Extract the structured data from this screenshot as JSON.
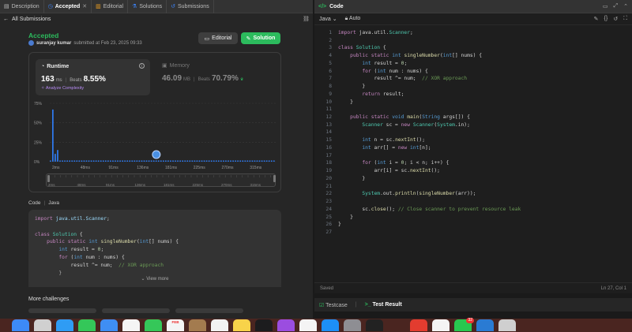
{
  "tabs": [
    {
      "label": "Description",
      "icon": "description-icon"
    },
    {
      "label": "Accepted",
      "icon": "history-icon",
      "active": true
    },
    {
      "label": "Editorial",
      "icon": "book-icon"
    },
    {
      "label": "Solutions",
      "icon": "flask-icon"
    },
    {
      "label": "Submissions",
      "icon": "clock-icon"
    }
  ],
  "back_label": "All Submissions",
  "result": {
    "status": "Accepted",
    "user": "suranjay kumar",
    "submitted_text": "submitted at Feb 23, 2025 09:33"
  },
  "buttons": {
    "editorial": "Editorial",
    "solution": "Solution"
  },
  "runtime": {
    "title": "Runtime",
    "value": "163",
    "unit": "ms",
    "beats_label": "Beats",
    "beats": "8.55%",
    "analyze": "Analyze Complexity"
  },
  "memory": {
    "title": "Memory",
    "value": "46.09",
    "unit": "MB",
    "beats_label": "Beats",
    "beats": "70.79%"
  },
  "chart_data": {
    "type": "bar",
    "y_ticks": [
      "75%",
      "50%",
      "25%",
      "0%"
    ],
    "ylim": [
      0,
      75
    ],
    "x_ticks": [
      "2ms",
      "48ms",
      "91ms",
      "136ms",
      "181ms",
      "225ms",
      "270ms",
      "315ms"
    ],
    "values": [
      1.5,
      67,
      10,
      15,
      1.5,
      1.5,
      1.5,
      1.5,
      1.5,
      1.5,
      1.5,
      1.5,
      1.5,
      1.5,
      1.5,
      1.5,
      1.5,
      1.5,
      1.5,
      1.5,
      1.5,
      1.5,
      1.5,
      1.5,
      1.5,
      1.5,
      1.5,
      1.5,
      1.5,
      1.5,
      1.5,
      1.5,
      1.5,
      1.5,
      1.5,
      1.5,
      1.5,
      1.5,
      1.5,
      1.5,
      1.5,
      1.5,
      1.5,
      1.5,
      1.5,
      1.5,
      1.5,
      1.5,
      1.5,
      1.5,
      1.5,
      1.5,
      1.5,
      1.5,
      1.5,
      1.5,
      1.5,
      1.5,
      1.5,
      1.5,
      1.5,
      1.5,
      1.5,
      1.5,
      1.5,
      1.5,
      1.5,
      1.5,
      1.5,
      1.5,
      1.5,
      1.5,
      1.5,
      1.5,
      1.5,
      1.5,
      1.5,
      1.5,
      1.5,
      1.5,
      1.5,
      1.5,
      1.5,
      1.5,
      1.5,
      1.5,
      1.5,
      1.5,
      1.5,
      1.5,
      1.5,
      1.5,
      1.5,
      1.5
    ],
    "marker_index": 44,
    "grid": true
  },
  "code_section": {
    "label": "Code",
    "lang": "Java",
    "view_more": "View more"
  },
  "more_label": "More challenges",
  "editor": {
    "title": "Code",
    "language": "Java",
    "mode": "Auto",
    "status_left": "Saved",
    "status_right": "Ln 27, Col 1",
    "lines": [
      "import java.util.Scanner;",
      "",
      "class Solution {",
      "    public static int singleNumber(int[] nums) {",
      "        int result = 0;",
      "        for (int num : nums) {",
      "            result ^= num;  // XOR approach",
      "        }",
      "        return result;",
      "    }",
      "",
      "    public static void main(String args[]) {",
      "        Scanner sc = new Scanner(System.in);",
      "",
      "        int n = sc.nextInt();",
      "        int arr[] = new int[n];",
      "",
      "        for (int i = 0; i < n; i++) {",
      "            arr[i] = sc.nextInt();",
      "        }",
      "",
      "        System.out.println(singleNumber(arr));",
      "",
      "        sc.close(); // Close scanner to prevent resource leak",
      "    }",
      "}",
      ""
    ]
  },
  "bottom_tabs": {
    "testcase": "Testcase",
    "result": "Test Result"
  },
  "dock": [
    {
      "name": "finder-icon",
      "color": "#3d8af7"
    },
    {
      "name": "launchpad-icon",
      "color": "#d0d0d0"
    },
    {
      "name": "safari-icon",
      "color": "#2f9cf4"
    },
    {
      "name": "messages-icon",
      "color": "#34c759"
    },
    {
      "name": "mail-icon",
      "color": "#3f8ef4"
    },
    {
      "name": "photos-icon",
      "color": "#f5f5f5"
    },
    {
      "name": "facetime-icon",
      "color": "#35c759"
    },
    {
      "name": "calendar-icon",
      "color": "#f4f4f4",
      "text": "FEB"
    },
    {
      "name": "keynote-icon",
      "color": "#a37b4f"
    },
    {
      "name": "reminders-icon",
      "color": "#f2f2f2"
    },
    {
      "name": "notes-icon",
      "color": "#f8d34a"
    },
    {
      "name": "appletv-icon",
      "color": "#1c1c1e"
    },
    {
      "name": "podcasts-icon",
      "color": "#9b4de0"
    },
    {
      "name": "news-icon",
      "color": "#f4f4f4"
    },
    {
      "name": "appstore-icon",
      "color": "#1d8ff6"
    },
    {
      "name": "settings-icon",
      "color": "#8e8e93"
    },
    {
      "name": "terminal-icon",
      "color": "#222"
    },
    {
      "name": "spacer-icon",
      "color": "transparent"
    },
    {
      "name": "app-icon",
      "color": "#e33c2f"
    },
    {
      "name": "chrome-icon",
      "color": "#f4f4f4"
    },
    {
      "name": "whatsapp-icon",
      "color": "#28c84f",
      "badge": "32"
    },
    {
      "name": "vscode-icon",
      "color": "#2a7bd3"
    },
    {
      "name": "trash-icon",
      "color": "#cfcfcf"
    }
  ]
}
